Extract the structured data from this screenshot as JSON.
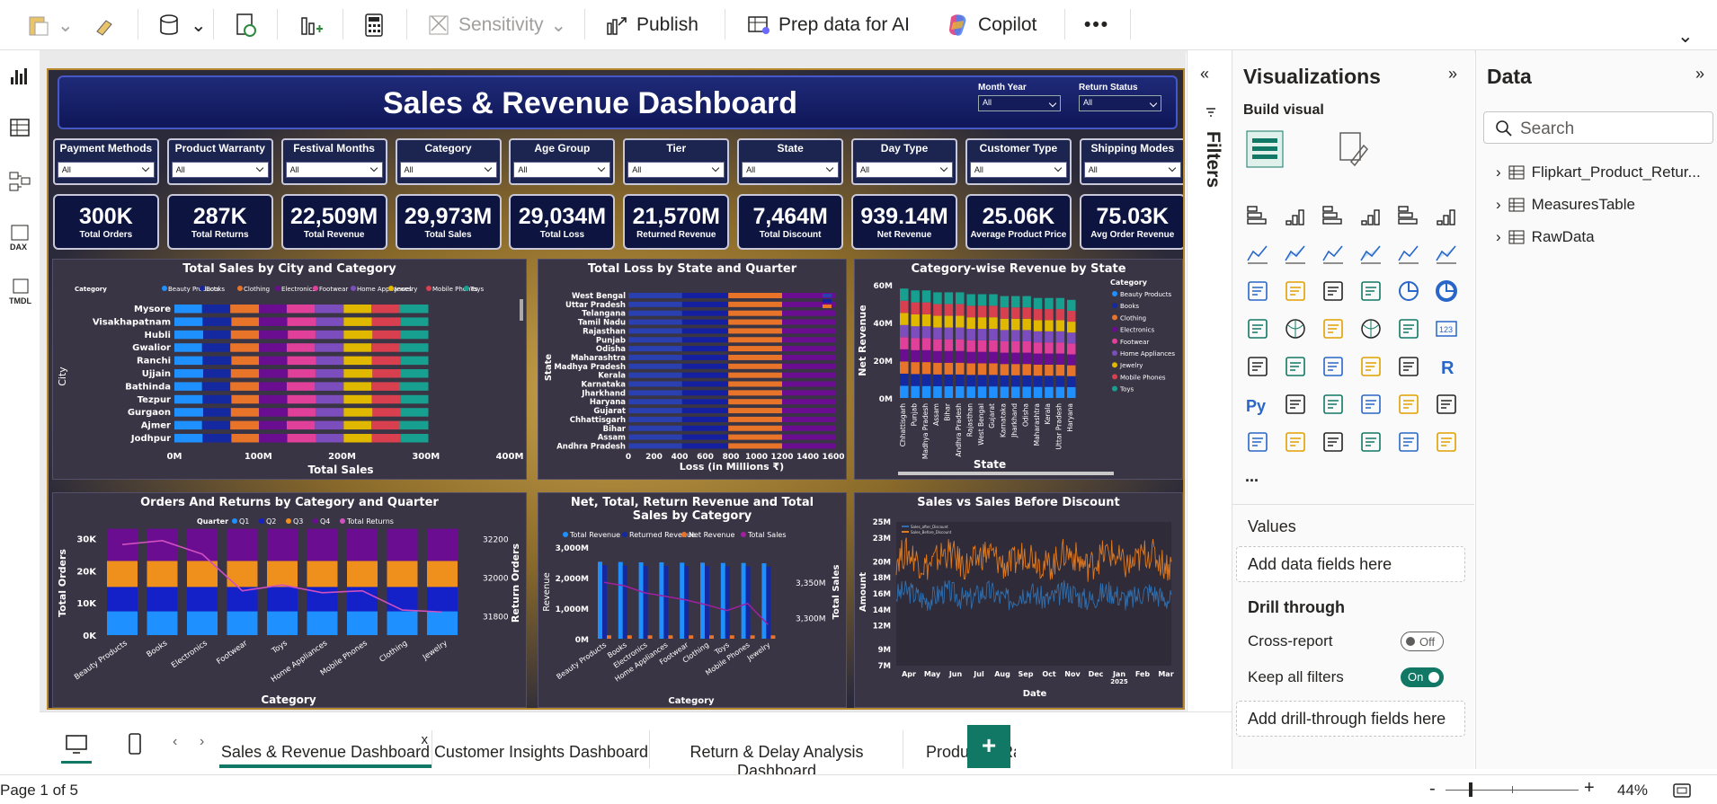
{
  "ribbon": {
    "sensitivity": "Sensitivity",
    "publish": "Publish",
    "prep": "Prep data for AI",
    "copilot": "Copilot",
    "more": "•••"
  },
  "report": {
    "title": "Sales & Revenue Dashboard",
    "top_slicers": [
      {
        "label": "Month Year",
        "value": "All"
      },
      {
        "label": "Return Status",
        "value": "All"
      }
    ],
    "slicers": [
      {
        "label": "Payment Methods",
        "value": "All"
      },
      {
        "label": "Product Warranty",
        "value": "All"
      },
      {
        "label": "Festival Months",
        "value": "All"
      },
      {
        "label": "Category",
        "value": "All"
      },
      {
        "label": "Age Group",
        "value": "All"
      },
      {
        "label": "Tier",
        "value": "All"
      },
      {
        "label": "State",
        "value": "All"
      },
      {
        "label": "Day Type",
        "value": "All"
      },
      {
        "label": "Customer Type",
        "value": "All"
      },
      {
        "label": "Shipping Modes",
        "value": "All"
      }
    ],
    "kpis": [
      {
        "value": "300K",
        "caption": "Total Orders"
      },
      {
        "value": "287K",
        "caption": "Total Returns"
      },
      {
        "value": "22,509M",
        "caption": "Total Revenue"
      },
      {
        "value": "29,973M",
        "caption": "Total Sales"
      },
      {
        "value": "29,034M",
        "caption": "Total Loss"
      },
      {
        "value": "21,570M",
        "caption": "Returned Revenue"
      },
      {
        "value": "7,464M",
        "caption": "Total Discount"
      },
      {
        "value": "939.14M",
        "caption": "Net Revenue"
      },
      {
        "value": "25.06K",
        "caption": "Average Product Price"
      },
      {
        "value": "75.03K",
        "caption": "Avg Order Revenue"
      }
    ]
  },
  "chart_data": [
    {
      "type": "bar",
      "orientation": "horizontal-stacked",
      "title": "Total Sales by City and Category",
      "xlabel": "Total Sales",
      "ylabel": "City",
      "legend_title": "Category",
      "legend": [
        "Beauty Products",
        "Books",
        "Clothing",
        "Electronics",
        "Footwear",
        "Home Appliances",
        "Jewelry",
        "Mobile Phones",
        "Toys"
      ],
      "categories": [
        "Mysore",
        "Visakhapatnam",
        "Hubli",
        "Gwalior",
        "Ranchi",
        "Ujjain",
        "Bathinda",
        "Tezpur",
        "Gurgaon",
        "Ajmer",
        "Jodhpur"
      ],
      "xticks": [
        "0M",
        "100M",
        "200M",
        "300M",
        "400M"
      ],
      "xlim": [
        0,
        400
      ],
      "segment_value": 33,
      "colors": [
        "#1e90ff",
        "#1428a0",
        "#e8742a",
        "#6a0d91",
        "#e0409a",
        "#7c4dbd",
        "#e0b800",
        "#d84050",
        "#17a090"
      ]
    },
    {
      "type": "bar",
      "orientation": "horizontal-stacked",
      "title": "Total Loss by State and Quarter",
      "xlabel": "Loss (in Millions ₹)",
      "ylabel": "State",
      "categories": [
        "West Bengal",
        "Uttar Pradesh",
        "Telangana",
        "Tamil Nadu",
        "Rajasthan",
        "Punjab",
        "Odisha",
        "Maharashtra",
        "Madhya Pradesh",
        "Kerala",
        "Karnataka",
        "Jharkhand",
        "Haryana",
        "Gujarat",
        "Chhattisgarh",
        "Bihar",
        "Assam",
        "Andhra Pradesh"
      ],
      "xticks": [
        "0",
        "200",
        "400",
        "600",
        "800",
        "1000",
        "1200",
        "1400",
        "1600"
      ],
      "xlim": [
        0,
        1600
      ],
      "quarter_values": [
        420,
        360,
        420,
        420
      ],
      "colors": [
        "#2a3fb0",
        "#1420a0",
        "#e8742a",
        "#6a0d91"
      ]
    },
    {
      "type": "bar",
      "orientation": "vertical-stacked",
      "title": "Category-wise Revenue by State",
      "xlabel": "State",
      "ylabel": "Net Revenue",
      "legend_title": "Category",
      "legend": [
        "Beauty Products",
        "Books",
        "Clothing",
        "Electronics",
        "Footwear",
        "Home Appliances",
        "Jewelry",
        "Mobile Phones",
        "Toys"
      ],
      "categories": [
        "Chhattisgarh",
        "Punjab",
        "Madhya Pradesh",
        "Assam",
        "Bihar",
        "Andhra Pradesh",
        "Rajasthan",
        "West Bengal",
        "Gujarat",
        "Karnataka",
        "Jharkhand",
        "Odisha",
        "Maharashtra",
        "Kerala",
        "Uttar Pradesh",
        "Haryana"
      ],
      "yticks": [
        "0M",
        "20M",
        "40M",
        "60M"
      ],
      "ylim": [
        0,
        60
      ],
      "totals": [
        58,
        57,
        57,
        56,
        56,
        56,
        55,
        55,
        55,
        54,
        54,
        54,
        53,
        53,
        53,
        52
      ],
      "colors": [
        "#1e90ff",
        "#1428a0",
        "#e8742a",
        "#6a0d91",
        "#e0409a",
        "#7c4dbd",
        "#e0b800",
        "#d84050",
        "#17a090"
      ]
    },
    {
      "type": "bar",
      "orientation": "vertical-stacked-with-line",
      "title": "Orders And Returns by Category and Quarter",
      "xlabel": "Category",
      "ylabel": "Total Orders",
      "y2label": "Return Orders",
      "legend_title": "Quarter",
      "legend": [
        "Q1",
        "Q2",
        "Q3",
        "Q4",
        "Total Returns"
      ],
      "categories": [
        "Beauty Products",
        "Books",
        "Electronics",
        "Footwear",
        "Toys",
        "Home Appliances",
        "Mobile Phones",
        "Clothing",
        "Jewelry"
      ],
      "yticks": [
        "0K",
        "10K",
        "20K",
        "30K"
      ],
      "ylim": [
        0,
        33
      ],
      "y2ticks": [
        "31800",
        "32000",
        "32200"
      ],
      "y2lim": [
        31700,
        32250
      ],
      "quarters": [
        7.4,
        7.6,
        8.1,
        10.0
      ],
      "returns": [
        32170,
        32190,
        32120,
        31930,
        31960,
        31920,
        31930,
        31830,
        31820
      ],
      "colors": [
        "#1e90ff",
        "#1420c8",
        "#f0901c",
        "#6a0d91",
        "#d050c0"
      ]
    },
    {
      "type": "bar",
      "orientation": "clustered-with-line",
      "title": "Net, Total, Return Revenue and Total Sales by Category",
      "xlabel": "Category",
      "ylabel": "Revenue",
      "y2label": "Total Sales",
      "legend": [
        "Total Revenue",
        "Returned Revenue",
        "Net Revenue",
        "Total Sales"
      ],
      "categories": [
        "Beauty Products",
        "Books",
        "Electronics",
        "Home Appliances",
        "Footwear",
        "Clothing",
        "Toys",
        "Mobile Phones",
        "Jewelry"
      ],
      "yticks": [
        "0M",
        "1,000M",
        "2,000M",
        "3,000M"
      ],
      "ylim": [
        0,
        3000
      ],
      "y2ticks": [
        "3,300M",
        "3,350M"
      ],
      "y2lim": [
        3270,
        3400
      ],
      "total_revenue": [
        2520,
        2510,
        2500,
        2500,
        2490,
        2490,
        2480,
        2480,
        2470
      ],
      "returned_revenue": [
        2410,
        2400,
        2390,
        2390,
        2380,
        2380,
        2370,
        2370,
        2360
      ],
      "net_revenue": [
        110,
        110,
        110,
        110,
        110,
        110,
        110,
        110,
        110
      ],
      "total_sales": [
        3350,
        3345,
        3335,
        3330,
        3325,
        3318,
        3310,
        3320,
        3290
      ],
      "colors": [
        "#1e90ff",
        "#1428a0",
        "#e8742a",
        "#a020a0"
      ]
    },
    {
      "type": "line",
      "title": "Sales vs Sales Before Discount",
      "xlabel": "Date",
      "ylabel": "Amount",
      "legend": [
        "Sales_after_Discount",
        "Sales_Before_Discount"
      ],
      "xticks": [
        "Apr",
        "May",
        "Jun",
        "Jul",
        "Aug",
        "Sep",
        "Oct",
        "Nov",
        "Dec",
        "Jan",
        "Feb",
        "Mar"
      ],
      "xsub": "2025",
      "yticks": [
        "7M",
        "9M",
        "12M",
        "14M",
        "16M",
        "18M",
        "20M",
        "23M",
        "25M"
      ],
      "ylim": [
        7,
        25
      ],
      "series_means": [
        15.8,
        20.3
      ],
      "colors": [
        "#2f6fb0",
        "#e07a20"
      ]
    }
  ],
  "filters_label": "Filters",
  "visualizations": {
    "title": "Visualizations",
    "build": "Build visual",
    "more": "...",
    "values": "Values",
    "values_well": "Add data fields here",
    "drill": "Drill through",
    "cross": "Cross-report",
    "cross_state": "Off",
    "keep": "Keep all filters",
    "keep_state": "On",
    "drill_well": "Add drill-through fields here"
  },
  "data_pane": {
    "title": "Data",
    "search": "Search",
    "tables": [
      "Flipkart_Product_Retur...",
      "MeasuresTable",
      "RawData"
    ]
  },
  "tabs": [
    "Sales & Revenue Dashboard",
    "Customer Insights Dashboard",
    "Return & Delay Analysis Dashboard",
    "Product & Rat"
  ],
  "tab_close": "x",
  "status": {
    "page": "Page 1 of 5",
    "zoom": "44%"
  }
}
